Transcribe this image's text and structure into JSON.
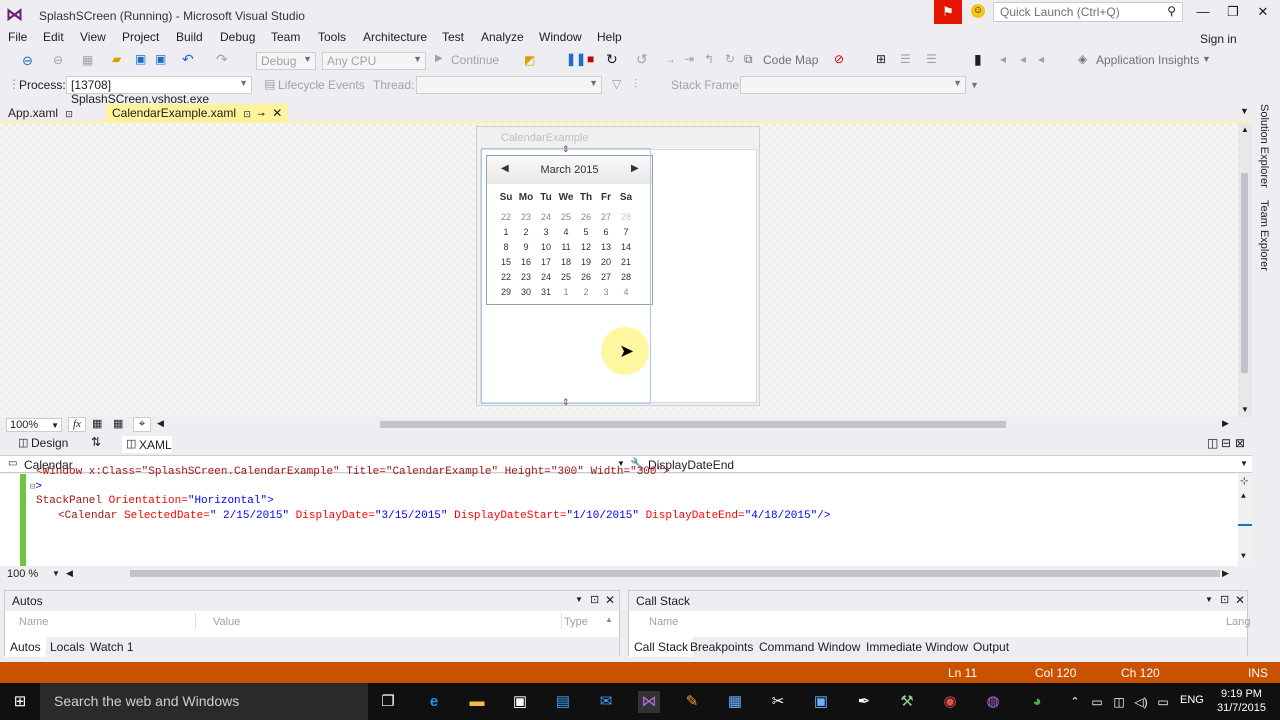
{
  "title_bar": {
    "title": "SplashSCreen (Running) - Microsoft Visual Studio",
    "quick_launch_placeholder": "Quick Launch (Ctrl+Q)",
    "minimize": "—",
    "restore": "❐",
    "close": "✕"
  },
  "menu": {
    "items": [
      "File",
      "Edit",
      "View",
      "Project",
      "Build",
      "Debug",
      "Team",
      "Tools",
      "Architecture",
      "Test",
      "Analyze",
      "Window",
      "Help"
    ],
    "sign_in": "Sign in"
  },
  "toolbar": {
    "config": "Debug",
    "platform": "Any CPU",
    "continue": "Continue",
    "code_map": "Code Map",
    "app_insights": "Application Insights"
  },
  "debug_location": {
    "process_label": "Process:",
    "process_value": "[13708] SplashSCreen.vshost.exe",
    "lifecycle": "Lifecycle Events",
    "thread_label": "Thread:",
    "stack_frame_label": "Stack Frame:"
  },
  "doc_tabs": [
    {
      "label": "App.xaml"
    },
    {
      "label": "CalendarExample.xaml"
    }
  ],
  "designer": {
    "window_title": "CalendarExample",
    "calendar": {
      "month": "March 2015",
      "dow": [
        "Su",
        "Mo",
        "Tu",
        "We",
        "Th",
        "Fr",
        "Sa"
      ],
      "weeks": [
        [
          "22",
          "23",
          "24",
          "25",
          "26",
          "27",
          "28"
        ],
        [
          "1",
          "2",
          "3",
          "4",
          "5",
          "6",
          "7"
        ],
        [
          "8",
          "9",
          "10",
          "11",
          "12",
          "13",
          "14"
        ],
        [
          "15",
          "16",
          "17",
          "18",
          "19",
          "20",
          "21"
        ],
        [
          "22",
          "23",
          "24",
          "25",
          "26",
          "27",
          "28"
        ],
        [
          "29",
          "30",
          "31",
          "1",
          "2",
          "3",
          "4"
        ]
      ]
    },
    "zoom": "100%"
  },
  "split_tabs": {
    "design": "Design",
    "swap": "⇅",
    "xaml": "XAML"
  },
  "nav": {
    "left": "Calendar",
    "right": "DisplayDateEnd"
  },
  "editor": {
    "line0": "<Window x:Class=\"SplashSCreen.CalendarExample\" Title=\"CalendarExample\" Height=\"300\" Width=\"300\">",
    "line1": ">",
    "line2_tag": "StackPanel",
    "line2_attr": " Orientation=",
    "line2_val": "\"Horizontal\"",
    "line3_tag": "<Calendar",
    "line3_a1": " SelectedDate=",
    "line3_v1": "\" 2/15/2015\"",
    "line3_a2": " DisplayDate=",
    "line3_v2": "\"3/15/2015\"",
    "line3_a3": " DisplayDateStart=",
    "line3_v3": "\"1/10/2015\"",
    "line3_a4": " DisplayDateEnd=",
    "line3_v4": "\"4/18/2015\"",
    "line3_end": "/>",
    "zoom": "100 %"
  },
  "autos": {
    "title": "Autos",
    "cols": [
      "Name",
      "Value",
      "Type"
    ],
    "tabs": [
      "Autos",
      "Locals",
      "Watch 1"
    ]
  },
  "callstack": {
    "title": "Call Stack",
    "cols": [
      "Name",
      "Lang"
    ],
    "tabs": [
      "Call Stack",
      "Breakpoints",
      "Command Window",
      "Immediate Window",
      "Output"
    ]
  },
  "status": {
    "ln": "Ln 11",
    "col": "Col 120",
    "ch": "Ch 120",
    "mode": "INS"
  },
  "side_panel": {
    "solution_explorer": "Solution Explorer",
    "team_explorer": "Team Explorer"
  },
  "taskbar": {
    "search": "Search the web and Windows",
    "lang": "ENG",
    "time": "9:19 PM",
    "date": "31/7/2015"
  },
  "colors": {
    "status_bar": "#ca5100",
    "active_tab": "#fff29d",
    "vs_purple": "#68217a"
  }
}
